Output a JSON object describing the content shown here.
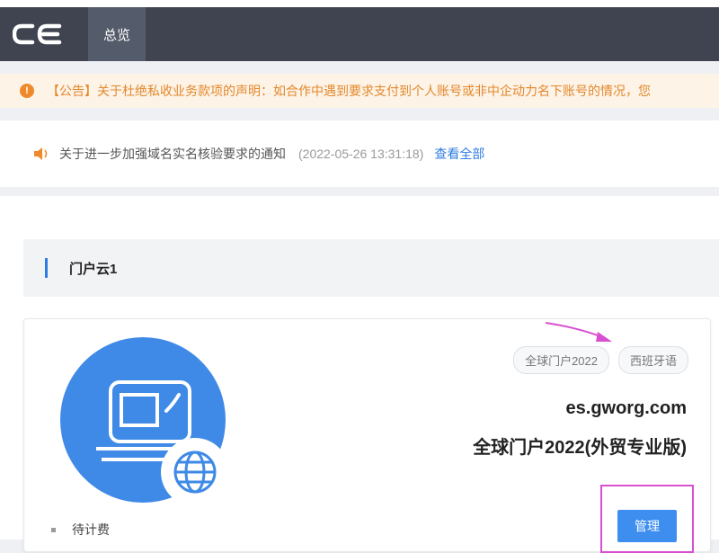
{
  "topbar": {
    "logo_icon": "ce-logo-icon",
    "nav_tab_label": "总览"
  },
  "announcement": {
    "icon": "exclamation-circle-icon",
    "text": "【公告】关于杜绝私收业务款项的声明：如合作中遇到要求支付到个人账号或非中企动力名下账号的情况，您"
  },
  "notice": {
    "icon": "speaker-icon",
    "text": "关于进一步加强域名实名核验要求的通知",
    "time": "(2022-05-26 13:31:18)",
    "view_all_label": "查看全部"
  },
  "section": {
    "title": "门户云1"
  },
  "site_card": {
    "icon": "laptop-globe-icon",
    "tags": [
      "全球门户2022",
      "西班牙语"
    ],
    "domain": "es.gworg.com",
    "product_name": "全球门户2022(外贸专业版)",
    "status": "待计费",
    "manage_label": "管理"
  },
  "colors": {
    "topbar": "#3f4450",
    "accent": "#2f7de1",
    "button": "#3e8ef0",
    "warning": "#e3882c",
    "highlight": "#d94fd1"
  }
}
